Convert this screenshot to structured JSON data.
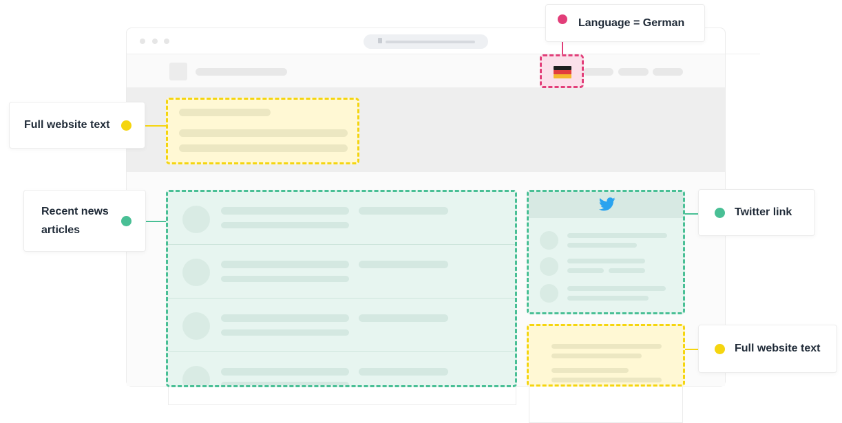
{
  "callouts": {
    "language": "Language = German",
    "full_text_top": "Full website text",
    "news": "Recent news articles",
    "twitter": "Twitter link",
    "full_text_bottom": "Full website text"
  },
  "colors": {
    "yellow": "#f5d50f",
    "green": "#49bf95",
    "pink": "#e23e79",
    "twitter": "#2aa3ef"
  },
  "icons": {
    "flag": "german-flag-icon",
    "twitter": "twitter-bird-icon"
  }
}
